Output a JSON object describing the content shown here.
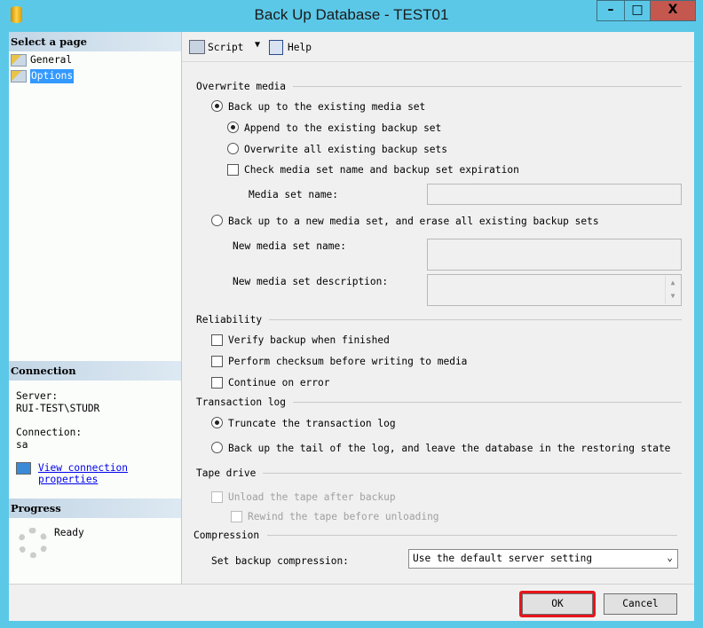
{
  "window": {
    "title": "Back Up Database - TEST01",
    "minimize": "–",
    "maximize": "□",
    "close": "X",
    "accent": "#5cc8e8",
    "close_color": "#c4574e"
  },
  "sidebar": {
    "select_header": "Select a page",
    "pages": [
      {
        "label": "General",
        "selected": false
      },
      {
        "label": "Options",
        "selected": true
      }
    ],
    "connection_header": "Connection",
    "server_label": "Server:",
    "server_value": "RUI-TEST\\STUDR",
    "connection_label": "Connection:",
    "connection_value": "sa",
    "view_link_1": "View connection ",
    "view_link_2": "properties",
    "progress_header": "Progress",
    "progress_status": "Ready"
  },
  "toolbar": {
    "script": "Script",
    "help": "Help"
  },
  "overwrite": {
    "header": "Overwrite media",
    "existing": "Back up to the existing media set",
    "append": "Append to the existing backup set",
    "overwrite_all": "Overwrite all existing backup sets",
    "check": "Check media set name and backup set expiration",
    "media_name_label": "Media set name:",
    "new_set": "Back up to a new media set, and erase all existing backup sets",
    "new_name_label": "New media set name:",
    "new_desc_label": "New media set description:"
  },
  "reliability": {
    "header": "Reliability",
    "verify": "Verify backup when finished",
    "checksum": "Perform checksum before writing to media",
    "continue": "Continue on error"
  },
  "txlog": {
    "header": "Transaction log",
    "truncate": "Truncate the transaction log",
    "tail": "Back up the tail of the log, and leave the database in the restoring state"
  },
  "tape": {
    "header": "Tape drive",
    "unload": "Unload the tape after backup",
    "rewind": "Rewind the tape before unloading"
  },
  "compression": {
    "header": "Compression",
    "label": "Set backup compression:",
    "value": "Use the default server setting"
  },
  "buttons": {
    "ok": "OK",
    "cancel": "Cancel",
    "highlight": "#e8141b"
  }
}
